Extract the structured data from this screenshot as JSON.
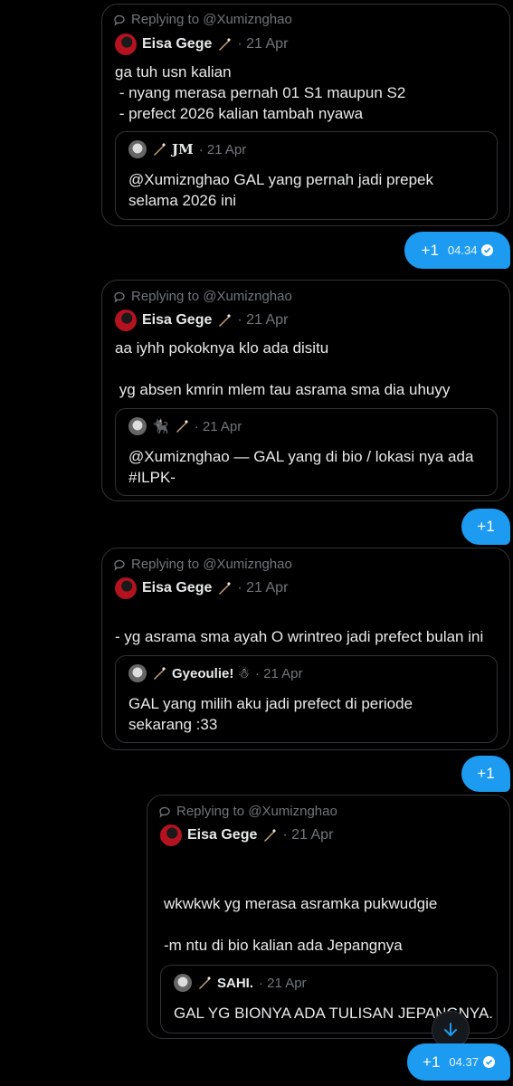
{
  "messages": [
    {
      "reply_to": "Replying to @Xumiznghao",
      "author": "Eisa Gege",
      "date": "· 21 Apr",
      "text": "ga tuh usn kalian\n - nyang merasa pernah 01 S1 maupun S2\n - prefect 2026 kalian tambah nyawa",
      "quote": {
        "author": "JM",
        "date": "· 21 Apr",
        "text": "@Xumiznghao GAL yang pernah jadi prepek\nselama 2026 ini"
      },
      "response": {
        "label": "+1",
        "time": "04.34",
        "read": true
      }
    },
    {
      "reply_to": "Replying to @Xumiznghao",
      "author": "Eisa Gege",
      "date": "· 21 Apr",
      "text": "aa iyhh pokoknya klo ada disitu\n\n yg absen kmrin mlem tau asrama sma dia uhuyy",
      "quote": {
        "author": "🐈‍⬛",
        "date": "· 21 Apr",
        "text": "@Xumiznghao — GAL yang di bio / lokasi nya ada\n#ILPK-"
      },
      "response": {
        "label": "+1"
      }
    },
    {
      "reply_to": "Replying to @Xumiznghao",
      "author": "Eisa Gege",
      "date": "· 21 Apr",
      "text": "- yg asrama sma ayah O wrintreo jadi prefect bulan ini",
      "quote": {
        "author": "Gyeoulie! ☃",
        "date": "· 21 Apr",
        "text": "GAL yang milih aku jadi prefect di periode\nsekarang :33"
      },
      "response": {
        "label": "+1"
      }
    },
    {
      "reply_to": "Replying to @Xumiznghao",
      "author": "Eisa Gege",
      "date": "· 21 Apr",
      "text": "wkwkwk yg merasa asramka pukwudgie\n\n-m ntu di bio kalian ada Jepangnya",
      "quote": {
        "author": "SAHI.",
        "date": "· 21 Apr",
        "text": "GAL YG BIONYA ADA TULISAN JEPANGNYA."
      },
      "response": {
        "label": "+1",
        "time": "04.37",
        "read": true
      }
    }
  ],
  "icons": {
    "reply": "reply-bubble-icon",
    "brush": "quill-icon",
    "check": "read-check-icon",
    "scroll": "arrow-down-icon"
  },
  "colors": {
    "accent": "#1d9bf0",
    "background": "#000000",
    "border": "#2f3336",
    "muted": "#71767b",
    "text": "#e7e9ea"
  }
}
